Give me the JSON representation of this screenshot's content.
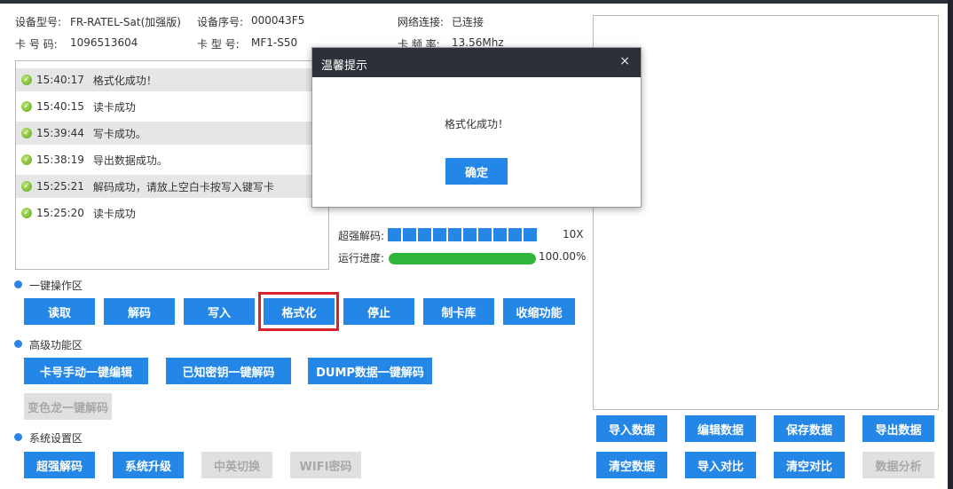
{
  "device": {
    "model_label": "设备型号:",
    "model_value": "FR-RATEL-Sat(加强版)",
    "serial_label": "设备序号:",
    "serial_value": "000043F5",
    "network_label": "网络连接:",
    "network_value": "已连接",
    "card_no_label": "卡 号 码:",
    "card_no_value": "1096513604",
    "card_type_label": "卡 型 号:",
    "card_type_value": "MF1-S50",
    "freq_label": "卡 频 率:",
    "freq_value": "13.56Mhz"
  },
  "log": [
    {
      "time": "15:40:17",
      "msg": "格式化成功！"
    },
    {
      "time": "15:40:15",
      "msg": "读卡成功"
    },
    {
      "time": "15:39:44",
      "msg": "写卡成功。"
    },
    {
      "time": "15:38:19",
      "msg": "导出数据成功。"
    },
    {
      "time": "15:25:21",
      "msg": "解码成功，请放上空白卡按写入键写卡"
    },
    {
      "time": "15:25:20",
      "msg": "读卡成功"
    }
  ],
  "progress": {
    "decode_label": "超强解码:",
    "decode_value": "10X",
    "decode_segments": 10,
    "run_label": "运行进度:",
    "run_value": "100.00%",
    "run_fraction": 1.0
  },
  "sections": {
    "one_click": "一键操作区",
    "advanced": "高级功能区",
    "system": "系统设置区"
  },
  "buttons": {
    "read": "读取",
    "decode": "解码",
    "write": "写入",
    "format": "格式化",
    "stop": "停止",
    "card_lib": "制卡库",
    "collapse": "收缩功能",
    "card_edit": "卡号手动一键编辑",
    "known_key": "已知密钥一键解码",
    "dump": "DUMP数据一键解码",
    "chameleon": "变色龙一键解码",
    "super_decode": "超强解码",
    "upgrade": "系统升级",
    "lang": "中英切换",
    "wifi": "WIFI密码",
    "import_data": "导入数据",
    "edit_data": "编辑数据",
    "save_data": "保存数据",
    "export_data": "导出数据",
    "clear_data": "清空数据",
    "import_compare": "导入对比",
    "clear_compare": "清空对比",
    "data_analysis": "数据分析"
  },
  "dialog": {
    "title": "温馨提示",
    "close": "×",
    "message": "格式化成功！",
    "ok": "确定"
  },
  "colors": {
    "accent": "#2486e6",
    "dialog_header": "#2d3038",
    "progress": "#2fb539",
    "highlight": "#d8232a"
  }
}
